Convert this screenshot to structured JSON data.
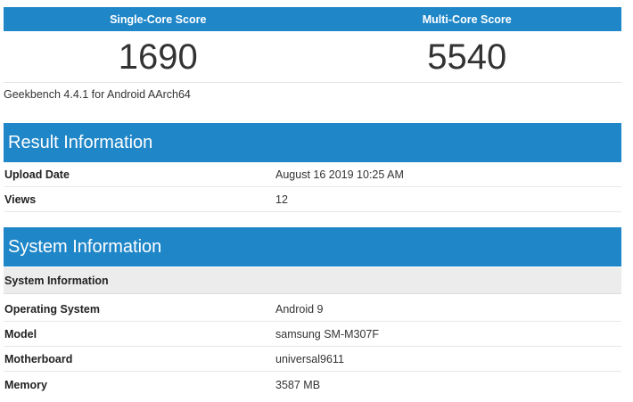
{
  "scores": {
    "single_core_label": "Single-Core Score",
    "multi_core_label": "Multi-Core Score",
    "single_core_value": "1690",
    "multi_core_value": "5540"
  },
  "version": "Geekbench 4.4.1 for Android AArch64",
  "result_info": {
    "title": "Result Information",
    "rows": [
      {
        "label": "Upload Date",
        "value": "August 16 2019 10:25 AM"
      },
      {
        "label": "Views",
        "value": "12"
      }
    ]
  },
  "system_info": {
    "title": "System Information",
    "subheader": "System Information",
    "rows": [
      {
        "label": "Operating System",
        "value": "Android 9"
      },
      {
        "label": "Model",
        "value": "samsung SM-M307F"
      },
      {
        "label": "Motherboard",
        "value": "universal9611"
      },
      {
        "label": "Memory",
        "value": "3587 MB"
      }
    ]
  },
  "colors": {
    "header_blue": "#1f86c8",
    "subheader_gray": "#ececec"
  }
}
